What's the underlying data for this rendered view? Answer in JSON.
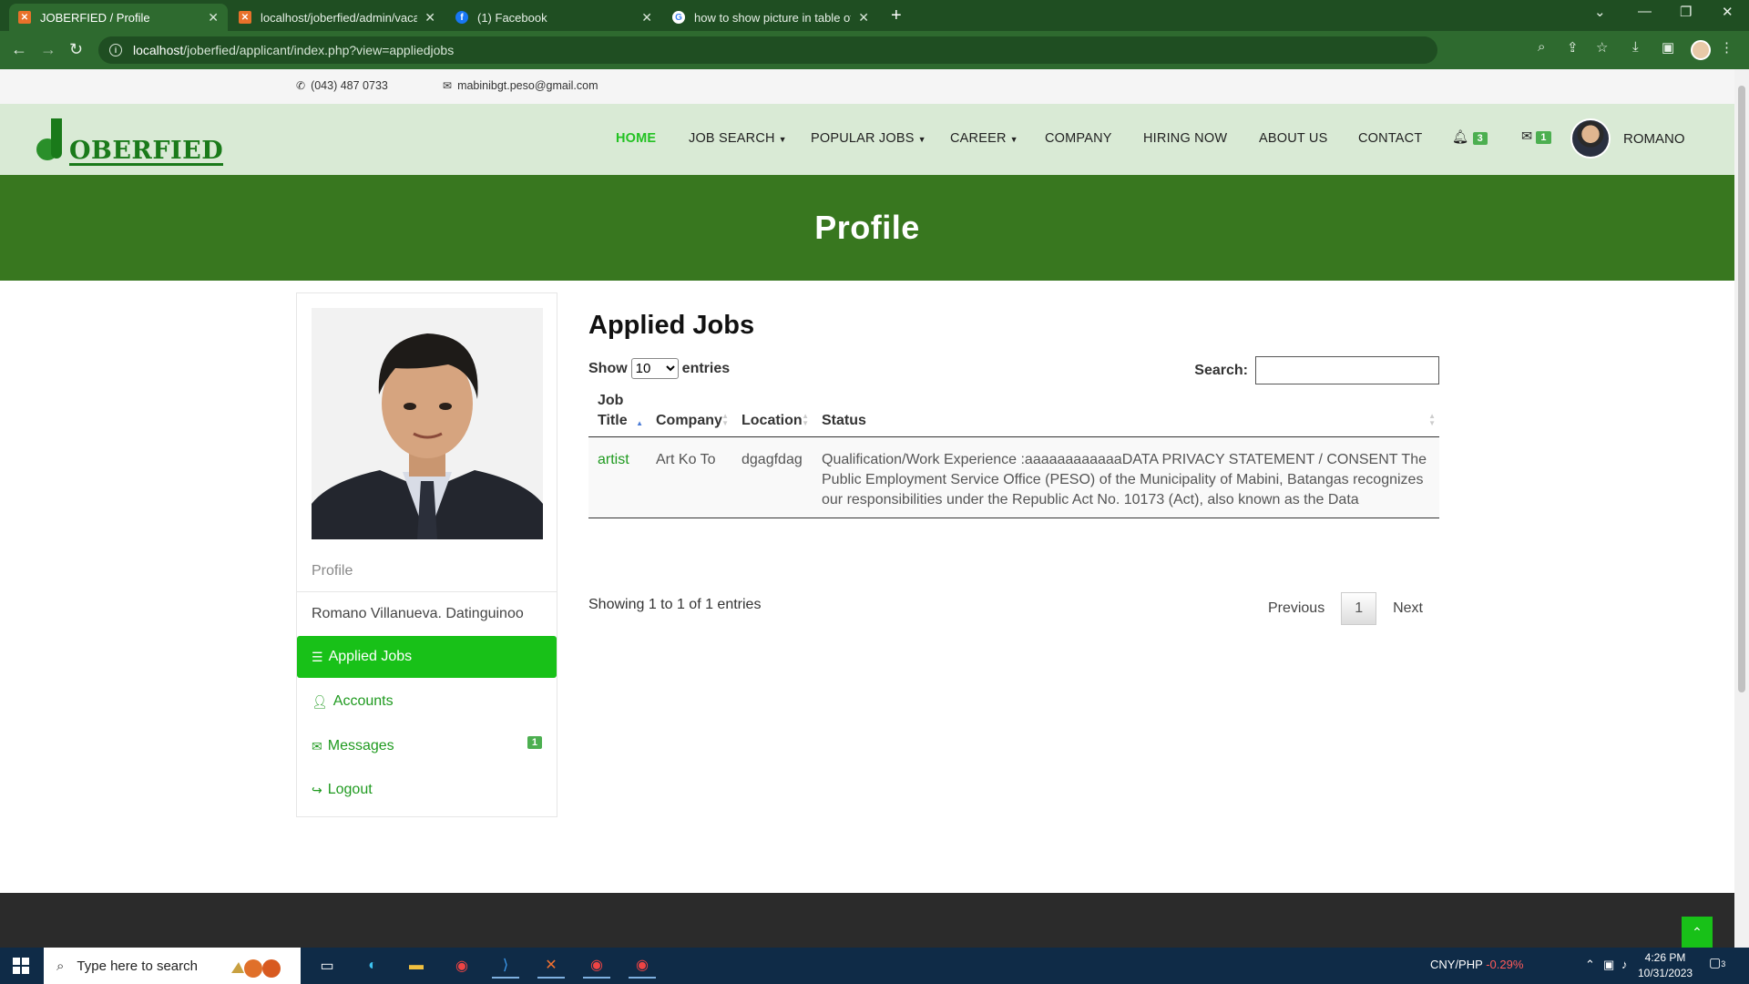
{
  "browser": {
    "tabs": [
      {
        "title": "JOBERFIED / Profile",
        "icon": "xampp-icon",
        "active": true
      },
      {
        "title": "localhost/joberfied/admin/vacan",
        "icon": "xampp-icon",
        "active": false
      },
      {
        "title": "(1) Facebook",
        "icon": "facebook-icon",
        "active": false
      },
      {
        "title": "how to show picture in table of",
        "icon": "google-icon",
        "active": false
      }
    ],
    "url_host": "localhost",
    "url_path": "/joberfied/applicant/index.php?view=appliedjobs"
  },
  "topinfo": {
    "phone": "(043) 487 0733",
    "email": "mabinibgt.peso@gmail.com"
  },
  "brand": {
    "logo_text": "OBERFIED"
  },
  "nav": {
    "home": "HOME",
    "job_search": "JOB SEARCH",
    "popular_jobs": "POPULAR JOBS",
    "career": "CAREER",
    "company": "COMPANY",
    "hiring_now": "HIRING NOW",
    "about_us": "ABOUT US",
    "contact": "CONTACT",
    "notifications_count": "3",
    "messages_count": "1",
    "username": "ROMANO"
  },
  "banner": {
    "title": "Profile"
  },
  "sidebar": {
    "section_label": "Profile",
    "full_name": "Romano Villanueva. Datinguinoo",
    "items": [
      {
        "label": "Applied Jobs",
        "icon": "list-icon",
        "active": true
      },
      {
        "label": "Accounts",
        "icon": "user-icon",
        "active": false
      },
      {
        "label": "Messages",
        "icon": "envelope-icon",
        "active": false,
        "badge": "1"
      },
      {
        "label": "Logout",
        "icon": "sign-out-icon",
        "active": false
      }
    ]
  },
  "main": {
    "heading": "Applied Jobs",
    "show_label": "Show",
    "entries_label": "entries",
    "page_length": "10",
    "search_label": "Search:",
    "search_value": "",
    "columns": [
      "Job\nTitle",
      "Company",
      "Location",
      "Status"
    ],
    "rows": [
      {
        "job_title": "artist",
        "company": "Art Ko To",
        "location": "dgagfdag",
        "status": "Qualification/Work Experience :aaaaaaaaaaaaDATA PRIVACY STATEMENT / CONSENT The Public Employment Service Office (PESO) of the Municipality of Mabini, Batangas recognizes our responsibilities under the Republic Act No. 10173 (Act), also known as the Data"
      }
    ],
    "info_text": "Showing 1 to 1 of 1 entries",
    "pager": {
      "previous": "Previous",
      "current": "1",
      "next": "Next"
    }
  },
  "taskbar": {
    "search_placeholder": "Type here to search",
    "currency_pair": "CNY/PHP",
    "currency_change": "-0.29%",
    "time": "4:26 PM",
    "date": "10/31/2023",
    "notification_count": "3"
  },
  "colors": {
    "accent_green": "#18c118",
    "banner_green": "#38771f",
    "nav_bg": "#d9ead5",
    "link_green": "#1f9a1f"
  }
}
